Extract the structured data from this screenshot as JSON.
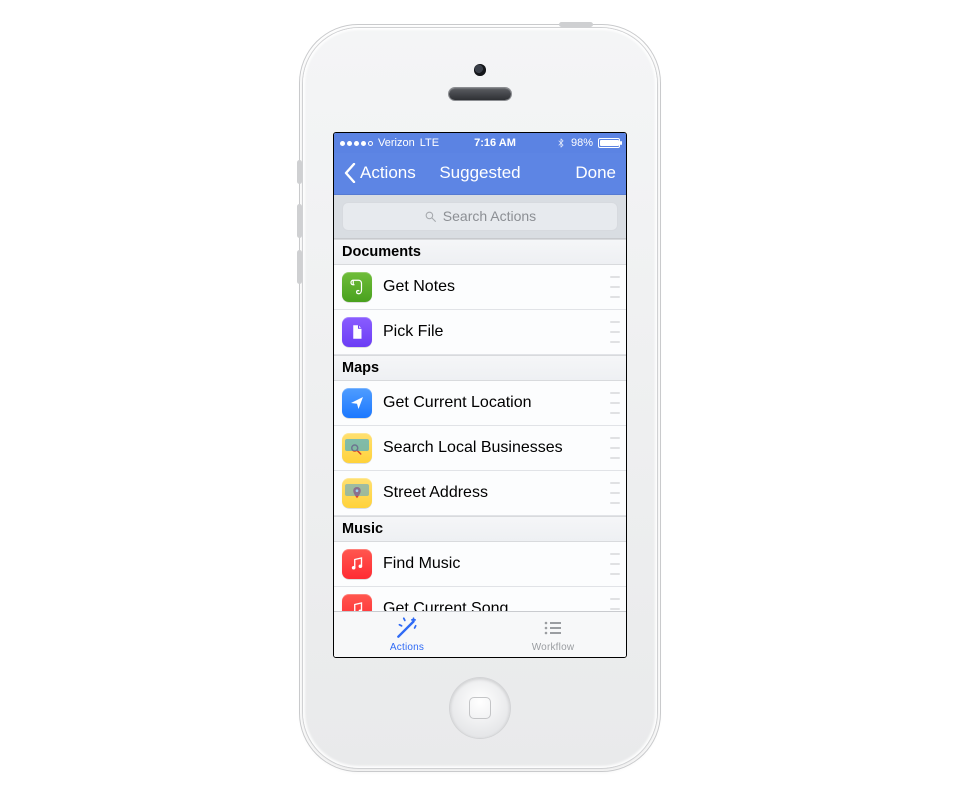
{
  "statusbar": {
    "carrier": "Verizon",
    "network": "LTE",
    "time": "7:16 AM",
    "battery_percent": "98%",
    "signal_filled": 4,
    "signal_total": 5
  },
  "navbar": {
    "back_label": "Actions",
    "title": "Suggested",
    "done_label": "Done"
  },
  "search": {
    "placeholder": "Search Actions"
  },
  "sections": [
    {
      "title": "Documents",
      "items": [
        "Get Notes",
        "Pick File"
      ]
    },
    {
      "title": "Maps",
      "items": [
        "Get Current Location",
        "Search Local Businesses",
        "Street Address"
      ]
    },
    {
      "title": "Music",
      "items": [
        "Find Music",
        "Get Current Song"
      ]
    }
  ],
  "tabbar": {
    "tabs": [
      "Actions",
      "Workflow"
    ],
    "active_index": 0
  }
}
